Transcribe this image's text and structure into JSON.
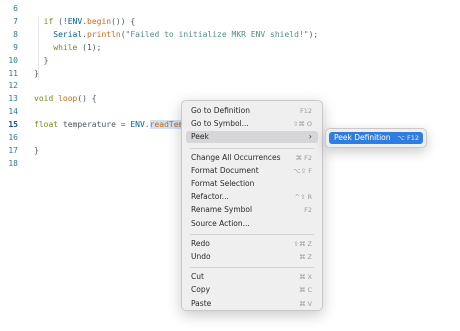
{
  "editor": {
    "lines": [
      {
        "num": "6",
        "parts": []
      },
      {
        "num": "7",
        "parts": [
          {
            "t": "  "
          },
          {
            "t": "if",
            "c": "kw"
          },
          {
            "t": " (!"
          },
          {
            "t": "ENV",
            "c": "id"
          },
          {
            "t": "."
          },
          {
            "t": "begin",
            "c": "fn"
          },
          {
            "t": "()) {"
          }
        ]
      },
      {
        "num": "8",
        "parts": [
          {
            "t": "    "
          },
          {
            "t": "Serial",
            "c": "id"
          },
          {
            "t": "."
          },
          {
            "t": "println",
            "c": "fn"
          },
          {
            "t": "("
          },
          {
            "t": "\"Failed to initialize MKR ENV shield!\"",
            "c": "str"
          },
          {
            "t": ");"
          }
        ]
      },
      {
        "num": "9",
        "parts": [
          {
            "t": "    "
          },
          {
            "t": "while",
            "c": "kw"
          },
          {
            "t": " (1);"
          }
        ]
      },
      {
        "num": "10",
        "parts": [
          {
            "t": "  }"
          }
        ]
      },
      {
        "num": "11",
        "parts": [
          {
            "t": "}"
          }
        ]
      },
      {
        "num": "12",
        "parts": []
      },
      {
        "num": "13",
        "parts": [
          {
            "t": "void",
            "c": "kw"
          },
          {
            "t": " "
          },
          {
            "t": "loop",
            "c": "fn"
          },
          {
            "t": "() {"
          }
        ]
      },
      {
        "num": "14",
        "parts": []
      },
      {
        "num": "15",
        "parts": [
          {
            "t": "float",
            "c": "kw"
          },
          {
            "t": " temperature = "
          },
          {
            "t": "ENV",
            "c": "id"
          },
          {
            "t": "."
          },
          {
            "t": "readTemper",
            "c": "fn sel"
          }
        ]
      },
      {
        "num": "16",
        "parts": []
      },
      {
        "num": "17",
        "parts": [
          {
            "t": "}"
          }
        ]
      },
      {
        "num": "18",
        "parts": []
      }
    ],
    "current_line": "15"
  },
  "context_menu": {
    "items": [
      {
        "label": "Go to Definition",
        "shortcut": "F12"
      },
      {
        "label": "Go to Symbol...",
        "shortcut": "⇧⌘ O"
      },
      {
        "label": "Peek",
        "shortcut": "",
        "submenu": true,
        "highlight": true
      },
      {
        "sep": true
      },
      {
        "label": "Change All Occurrences",
        "shortcut": "⌘ F2"
      },
      {
        "label": "Format Document",
        "shortcut": "⌥⇧ F"
      },
      {
        "label": "Format Selection",
        "shortcut": ""
      },
      {
        "label": "Refactor...",
        "shortcut": "^⇧ R"
      },
      {
        "label": "Rename Symbol",
        "shortcut": "F2"
      },
      {
        "label": "Source Action...",
        "shortcut": ""
      },
      {
        "sep": true
      },
      {
        "label": "Redo",
        "shortcut": "⇧⌘ Z"
      },
      {
        "label": "Undo",
        "shortcut": "⌘ Z"
      },
      {
        "sep": true
      },
      {
        "label": "Cut",
        "shortcut": "⌘ X"
      },
      {
        "label": "Copy",
        "shortcut": "⌘ C"
      },
      {
        "label": "Paste",
        "shortcut": "⌘ V"
      }
    ]
  },
  "submenu": {
    "label": "Peek Definition",
    "shortcut": "⌥ F12"
  }
}
